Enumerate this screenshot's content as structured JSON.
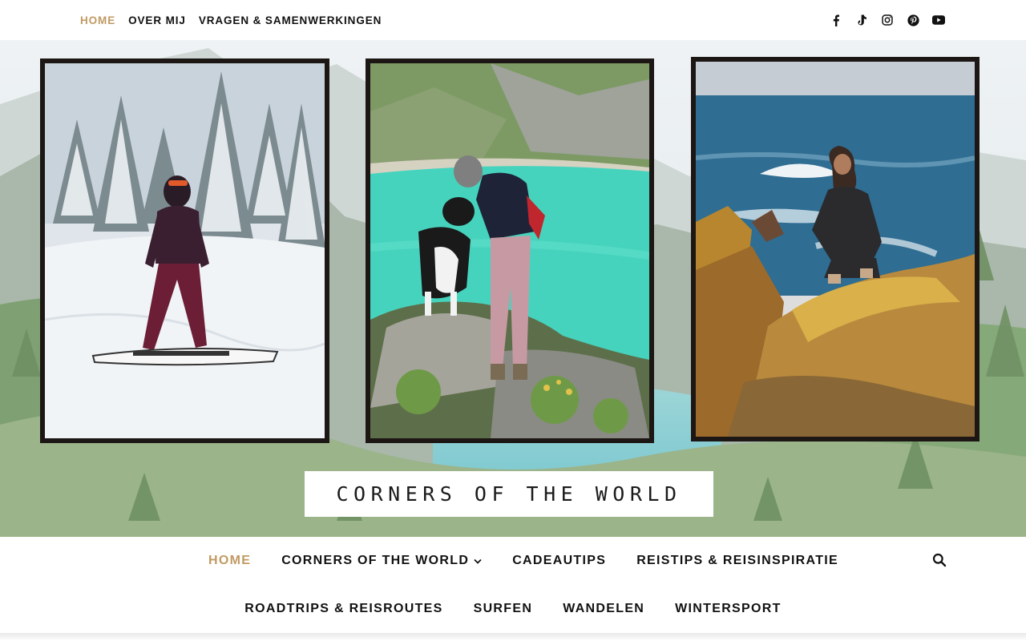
{
  "top_nav": {
    "items": [
      {
        "label": "HOME",
        "active": true
      },
      {
        "label": "OVER MIJ",
        "active": false
      },
      {
        "label": "VRAGEN & SAMENWERKINGEN",
        "active": false
      }
    ]
  },
  "socials": [
    "facebook-icon",
    "tiktok-icon",
    "instagram-icon",
    "pinterest-icon",
    "youtube-icon"
  ],
  "hero": {
    "site_title": "CORNERS OF THE WORLD",
    "photos": [
      "snowboard-photo",
      "lake-dog-photo",
      "coast-rocks-photo"
    ]
  },
  "main_nav": {
    "row1": [
      {
        "label": "HOME",
        "active": true
      },
      {
        "label": "CORNERS OF THE WORLD",
        "active": false,
        "dropdown": true
      },
      {
        "label": "CADEAUTIPS",
        "active": false
      },
      {
        "label": "REISTIPS & REISINSPIRATIE",
        "active": false
      }
    ],
    "row2": [
      {
        "label": "ROADTRIPS & REISROUTES"
      },
      {
        "label": "SURFEN"
      },
      {
        "label": "WANDELEN"
      },
      {
        "label": "WINTERSPORT"
      }
    ],
    "search_icon": "search-icon"
  },
  "colors": {
    "accent": "#c19a62",
    "text": "#111111",
    "frame": "#1c1714"
  }
}
